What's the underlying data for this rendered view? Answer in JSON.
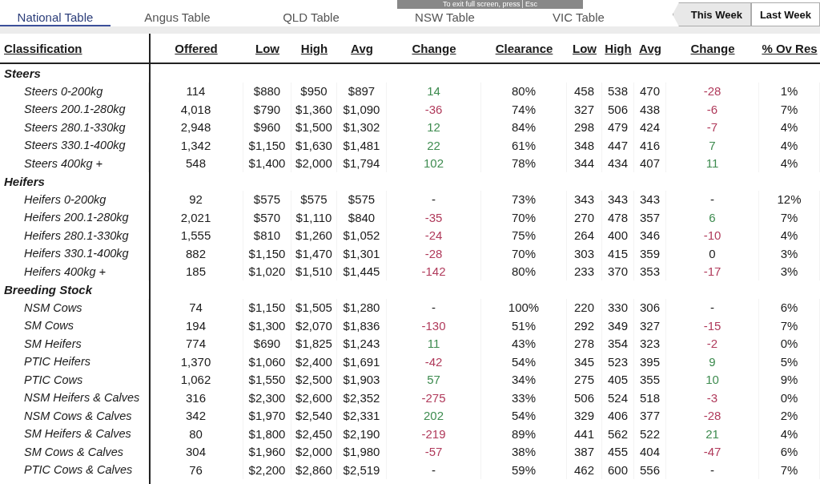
{
  "tabs": [
    {
      "label": "National Table",
      "selected": true
    },
    {
      "label": "Angus Table",
      "selected": false
    },
    {
      "label": "QLD Table",
      "selected": false
    },
    {
      "label": "NSW Table",
      "selected": false
    },
    {
      "label": "VIC Table",
      "selected": false
    }
  ],
  "fullscreen_notice": {
    "text": "To exit full screen, press",
    "key": "Esc"
  },
  "week_buttons": [
    {
      "label": "This Week",
      "selected": true
    },
    {
      "label": "Last Week",
      "selected": false
    }
  ],
  "columns": [
    "Classification",
    "Offered",
    "Low",
    "High",
    "Avg",
    "Change",
    "Clearance",
    "Low",
    "High",
    "Avg",
    "Change",
    "% Ov Res"
  ],
  "groups": [
    {
      "label": "Steers",
      "rows": [
        {
          "label": "Steers 0-200kg",
          "cells": [
            "114",
            "$880",
            "$950",
            "$897",
            {
              "text": "14",
              "color": "#3d8b4f"
            },
            "80%",
            "458",
            "538",
            "470",
            {
              "text": "-28",
              "color": "#b03a5b"
            },
            "1%"
          ]
        },
        {
          "label": "Steers 200.1-280kg",
          "cells": [
            "4,018",
            "$790",
            "$1,360",
            "$1,090",
            {
              "text": "-36",
              "color": "#b03a5b"
            },
            "74%",
            "327",
            "506",
            "438",
            {
              "text": "-6",
              "color": "#b03a5b"
            },
            "7%"
          ]
        },
        {
          "label": "Steers 280.1-330kg",
          "cells": [
            "2,948",
            "$960",
            "$1,500",
            "$1,302",
            {
              "text": "12",
              "color": "#3d8b4f"
            },
            "84%",
            "298",
            "479",
            "424",
            {
              "text": "-7",
              "color": "#b03a5b"
            },
            "4%"
          ]
        },
        {
          "label": "Steers 330.1-400kg",
          "cells": [
            "1,342",
            "$1,150",
            "$1,630",
            "$1,481",
            {
              "text": "22",
              "color": "#3d8b4f"
            },
            "61%",
            "348",
            "447",
            "416",
            {
              "text": "7",
              "color": "#3d8b4f"
            },
            "4%"
          ]
        },
        {
          "label": "Steers 400kg +",
          "cells": [
            "548",
            "$1,400",
            "$2,000",
            "$1,794",
            {
              "text": "102",
              "color": "#3d8b4f"
            },
            "78%",
            "344",
            "434",
            "407",
            {
              "text": "11",
              "color": "#3d8b4f"
            },
            "4%"
          ]
        }
      ]
    },
    {
      "label": "Heifers",
      "rows": [
        {
          "label": "Heifers 0-200kg",
          "cells": [
            "92",
            "$575",
            "$575",
            "$575",
            {
              "text": "-",
              "color": "#1a1a1a"
            },
            "73%",
            "343",
            "343",
            "343",
            {
              "text": "-",
              "color": "#1a1a1a"
            },
            "12%"
          ]
        },
        {
          "label": "Heifers 200.1-280kg",
          "cells": [
            "2,021",
            "$570",
            "$1,110",
            "$840",
            {
              "text": "-35",
              "color": "#b03a5b"
            },
            "70%",
            "270",
            "478",
            "357",
            {
              "text": "6",
              "color": "#3d8b4f"
            },
            "7%"
          ]
        },
        {
          "label": "Heifers 280.1-330kg",
          "cells": [
            "1,555",
            "$810",
            "$1,260",
            "$1,052",
            {
              "text": "-24",
              "color": "#b03a5b"
            },
            "75%",
            "264",
            "400",
            "346",
            {
              "text": "-10",
              "color": "#b03a5b"
            },
            "4%"
          ]
        },
        {
          "label": "Heifers 330.1-400kg",
          "cells": [
            "882",
            "$1,150",
            "$1,470",
            "$1,301",
            {
              "text": "-28",
              "color": "#b03a5b"
            },
            "70%",
            "303",
            "415",
            "359",
            {
              "text": "0",
              "color": "#1a1a1a"
            },
            "3%"
          ]
        },
        {
          "label": "Heifers 400kg +",
          "cells": [
            "185",
            "$1,020",
            "$1,510",
            "$1,445",
            {
              "text": "-142",
              "color": "#b03a5b"
            },
            "80%",
            "233",
            "370",
            "353",
            {
              "text": "-17",
              "color": "#b03a5b"
            },
            "3%"
          ]
        }
      ]
    },
    {
      "label": "Breeding Stock",
      "rows": [
        {
          "label": "NSM Cows",
          "cells": [
            "74",
            "$1,150",
            "$1,505",
            "$1,280",
            {
              "text": "-",
              "color": "#1a1a1a"
            },
            "100%",
            "220",
            "330",
            "306",
            {
              "text": "-",
              "color": "#1a1a1a"
            },
            "6%"
          ]
        },
        {
          "label": "SM Cows",
          "cells": [
            "194",
            "$1,300",
            "$2,070",
            "$1,836",
            {
              "text": "-130",
              "color": "#b03a5b"
            },
            "51%",
            "292",
            "349",
            "327",
            {
              "text": "-15",
              "color": "#b03a5b"
            },
            "7%"
          ]
        },
        {
          "label": "SM Heifers",
          "cells": [
            "774",
            "$690",
            "$1,825",
            "$1,243",
            {
              "text": "11",
              "color": "#3d8b4f"
            },
            "43%",
            "278",
            "354",
            "323",
            {
              "text": "-2",
              "color": "#b03a5b"
            },
            "0%"
          ]
        },
        {
          "label": "PTIC Heifers",
          "cells": [
            "1,370",
            "$1,060",
            "$2,400",
            "$1,691",
            {
              "text": "-42",
              "color": "#b03a5b"
            },
            "54%",
            "345",
            "523",
            "395",
            {
              "text": "9",
              "color": "#3d8b4f"
            },
            "5%"
          ]
        },
        {
          "label": "PTIC Cows",
          "cells": [
            "1,062",
            "$1,550",
            "$2,500",
            "$1,903",
            {
              "text": "57",
              "color": "#3d8b4f"
            },
            "34%",
            "275",
            "405",
            "355",
            {
              "text": "10",
              "color": "#3d8b4f"
            },
            "9%"
          ]
        },
        {
          "label": "NSM Heifers & Calves",
          "cells": [
            "316",
            "$2,300",
            "$2,600",
            "$2,352",
            {
              "text": "-275",
              "color": "#b03a5b"
            },
            "33%",
            "506",
            "524",
            "518",
            {
              "text": "-3",
              "color": "#b03a5b"
            },
            "0%"
          ]
        },
        {
          "label": "NSM Cows & Calves",
          "cells": [
            "342",
            "$1,970",
            "$2,540",
            "$2,331",
            {
              "text": "202",
              "color": "#3d8b4f"
            },
            "54%",
            "329",
            "406",
            "377",
            {
              "text": "-28",
              "color": "#b03a5b"
            },
            "2%"
          ]
        },
        {
          "label": "SM Heifers & Calves",
          "cells": [
            "80",
            "$1,800",
            "$2,450",
            "$2,190",
            {
              "text": "-219",
              "color": "#b03a5b"
            },
            "89%",
            "441",
            "562",
            "522",
            {
              "text": "21",
              "color": "#3d8b4f"
            },
            "4%"
          ]
        },
        {
          "label": "SM Cows & Calves",
          "cells": [
            "304",
            "$1,960",
            "$2,000",
            "$1,980",
            {
              "text": "-57",
              "color": "#b03a5b"
            },
            "38%",
            "387",
            "455",
            "404",
            {
              "text": "-47",
              "color": "#b03a5b"
            },
            "6%"
          ]
        },
        {
          "label": "PTIC Cows & Calves",
          "cells": [
            "76",
            "$2,200",
            "$2,860",
            "$2,519",
            {
              "text": "-",
              "color": "#1a1a1a"
            },
            "59%",
            "462",
            "600",
            "556",
            {
              "text": "-",
              "color": "#1a1a1a"
            },
            "7%"
          ]
        }
      ]
    }
  ]
}
